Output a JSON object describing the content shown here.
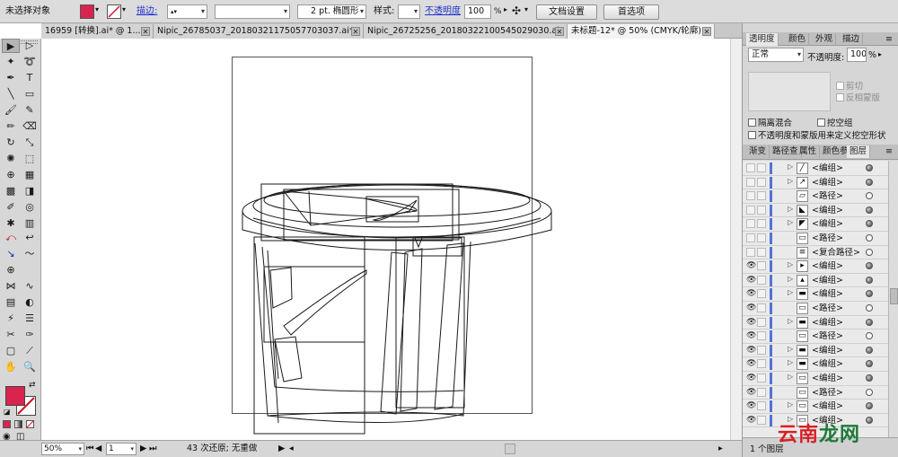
{
  "control_bar": {
    "selection_status": "未选择对象",
    "fill_color": "#d8244e",
    "stroke_label": "描边:",
    "stroke_weight": "",
    "brush_field": "",
    "brush_profile": "2 pt. 椭圆形",
    "style_label": "样式:",
    "opacity_label": "不透明度",
    "opacity_value": "100",
    "opacity_unit": "%",
    "document_setup_button": "文档设置",
    "preferences_button": "首选项"
  },
  "tabs": [
    {
      "title": "16959 [转换].ai* @ 1...",
      "active": false
    },
    {
      "title": "Nipic_26785037_20180321175057703037.ai*",
      "active": false
    },
    {
      "title": "Nipic_26725256_20180322100545029030.ai*",
      "active": false
    },
    {
      "title": "未标题-12* @ 50% (CMYK/轮廓)",
      "active": true
    }
  ],
  "tab_close_glyph": "✕",
  "toolbox": {
    "tools": [
      {
        "icon": "selection-tool",
        "glyph": "▶"
      },
      {
        "icon": "direct-selection-tool",
        "glyph": "▷"
      },
      {
        "icon": "magic-wand-tool",
        "glyph": "✦"
      },
      {
        "icon": "lasso-tool",
        "glyph": "➰"
      },
      {
        "icon": "pen-tool",
        "glyph": "✒"
      },
      {
        "icon": "type-tool",
        "glyph": "T"
      },
      {
        "icon": "line-segment-tool",
        "glyph": "╲"
      },
      {
        "icon": "rectangle-tool",
        "glyph": "▭"
      },
      {
        "icon": "paintbrush-tool",
        "glyph": "🖌"
      },
      {
        "icon": "pencil-tool",
        "glyph": "✎"
      },
      {
        "icon": "blob-brush-tool",
        "glyph": "✏"
      },
      {
        "icon": "eraser-tool",
        "glyph": "⌫"
      },
      {
        "icon": "rotate-tool",
        "glyph": "↻"
      },
      {
        "icon": "scale-tool",
        "glyph": "⤡"
      },
      {
        "icon": "warp-tool",
        "glyph": "✺"
      },
      {
        "icon": "free-transform-tool",
        "glyph": "⬚"
      },
      {
        "icon": "shape-builder-tool",
        "glyph": "⊕"
      },
      {
        "icon": "perspective-grid-tool",
        "glyph": "▦"
      },
      {
        "icon": "mesh-tool",
        "glyph": "▩"
      },
      {
        "icon": "gradient-tool",
        "glyph": "◨"
      },
      {
        "icon": "eyedropper-tool",
        "glyph": "✐"
      },
      {
        "icon": "blend-tool",
        "glyph": "◎"
      },
      {
        "icon": "symbol-sprayer-tool",
        "glyph": "✱"
      },
      {
        "icon": "column-graph-tool",
        "glyph": "▥"
      },
      {
        "icon": "width-tool",
        "glyph": "⤺"
      },
      {
        "icon": "width-alt-tool",
        "glyph": "↩"
      },
      {
        "icon": "knife-tool",
        "glyph": "↘"
      },
      {
        "icon": "scissors-tool",
        "glyph": "〜"
      },
      {
        "icon": "crosshair-tool",
        "glyph": "⊕"
      },
      {
        "icon": "crosshair-alt-tool",
        "glyph": ""
      },
      {
        "icon": "warp-mesh-tool",
        "glyph": "⋈"
      },
      {
        "icon": "wave-tool",
        "glyph": "∿"
      },
      {
        "icon": "graph-tool",
        "glyph": "▤"
      },
      {
        "icon": "blend-alt-tool",
        "glyph": "◐"
      },
      {
        "icon": "zigzag-tool",
        "glyph": "⚡"
      },
      {
        "icon": "align-tool",
        "glyph": "☰"
      },
      {
        "icon": "slice-tool",
        "glyph": "✂"
      },
      {
        "icon": "eyedropper-alt-tool",
        "glyph": "✑"
      },
      {
        "icon": "artboard-tool",
        "glyph": "▢"
      },
      {
        "icon": "slice-select-tool",
        "glyph": "⟋"
      },
      {
        "icon": "hand-tool",
        "glyph": "✋"
      },
      {
        "icon": "zoom-tool",
        "glyph": "🔍"
      }
    ]
  },
  "status_bar": {
    "zoom": "50%",
    "artboard_number": "1",
    "status_text": "43 次还原; 无重做"
  },
  "transparency_panel": {
    "tabs": [
      "透明度",
      "颜色",
      "外观",
      "描边"
    ],
    "blend_mode": "正常",
    "opacity_label": "不透明度:",
    "opacity_value": "100",
    "opacity_unit": "%",
    "clip_label": "剪切",
    "invert_mask_label": "反相蒙版",
    "isolate_blending_label": "隔离混合",
    "knockout_group_label": "挖空组",
    "opacity_mask_label": "不透明度和蒙版用来定义挖空形状"
  },
  "layers_panel": {
    "tabs": [
      "渐变",
      "路径查",
      "属性",
      "颜色参",
      "图层"
    ],
    "rows": [
      {
        "name": "<编组>",
        "visible": false,
        "expander": true,
        "target_filled": true
      },
      {
        "name": "<编组>",
        "visible": false,
        "expander": true,
        "target_filled": true
      },
      {
        "name": "<路径>",
        "visible": false,
        "expander": false,
        "target_filled": false
      },
      {
        "name": "<编组>",
        "visible": false,
        "expander": true,
        "target_filled": true
      },
      {
        "name": "<编组>",
        "visible": false,
        "expander": true,
        "target_filled": true
      },
      {
        "name": "<路径>",
        "visible": false,
        "expander": false,
        "target_filled": false
      },
      {
        "name": "<复合路径>",
        "visible": false,
        "expander": false,
        "target_filled": false
      },
      {
        "name": "<编组>",
        "visible": true,
        "expander": true,
        "target_filled": true
      },
      {
        "name": "<编组>",
        "visible": true,
        "expander": true,
        "target_filled": true
      },
      {
        "name": "<编组>",
        "visible": true,
        "expander": true,
        "target_filled": true
      },
      {
        "name": "<路径>",
        "visible": true,
        "expander": false,
        "target_filled": false
      },
      {
        "name": "<编组>",
        "visible": true,
        "expander": true,
        "target_filled": true
      },
      {
        "name": "<路径>",
        "visible": true,
        "expander": false,
        "target_filled": false
      },
      {
        "name": "<编组>",
        "visible": true,
        "expander": true,
        "target_filled": true
      },
      {
        "name": "<编组>",
        "visible": true,
        "expander": true,
        "target_filled": true
      },
      {
        "name": "<编组>",
        "visible": true,
        "expander": true,
        "target_filled": true
      },
      {
        "name": "<路径>",
        "visible": true,
        "expander": false,
        "target_filled": false
      },
      {
        "name": "<编组>",
        "visible": true,
        "expander": true,
        "target_filled": true
      },
      {
        "name": "<编组>",
        "visible": true,
        "expander": true,
        "target_filled": true
      }
    ],
    "footer_text": "1 个图层"
  },
  "watermark": {
    "part1": "云南",
    "part2": "龙网"
  }
}
